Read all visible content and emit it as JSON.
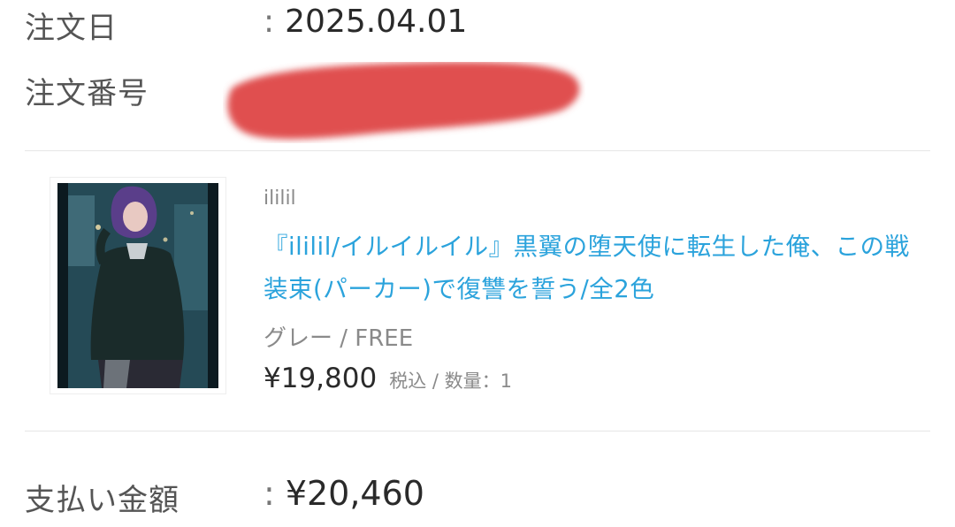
{
  "order": {
    "date_label": "注文日",
    "date_colon": ":",
    "date_value": "2025.04.01",
    "number_label": "注文番号"
  },
  "item": {
    "shop": "ililil",
    "title": "『ililil/イルイルイル』黒翼の堕天使に転生した俺、この戦装束(パーカー)で復讐を誓う/全2色",
    "variant": "グレー / FREE",
    "price": "¥19,800",
    "price_note": "税込 / 数量：1"
  },
  "payment": {
    "label": "支払い金額",
    "colon": ":",
    "value": "¥20,460"
  },
  "colors": {
    "link": "#2ba3dc",
    "redaction": "#e05050"
  }
}
